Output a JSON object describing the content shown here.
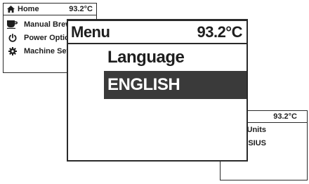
{
  "home_screen": {
    "title": "Home",
    "title_icon": "house-icon",
    "temperature": "93.2°C",
    "items": [
      {
        "label": "Manual Brew",
        "icon": "coffee-cup-icon"
      },
      {
        "label": "Power Options",
        "icon": "power-icon"
      },
      {
        "label": "Machine Settings",
        "icon": "gear-icon"
      }
    ]
  },
  "menu_screen": {
    "title": "Menu",
    "temperature": "93.2°C",
    "setting_label": "Language",
    "selected_option": "ENGLISH",
    "highlight_color": "#3a3a3a"
  },
  "temp_units_screen": {
    "temperature": "93.2°C",
    "setting_label": "Temp Units",
    "selected_option": "CELSIUS"
  }
}
